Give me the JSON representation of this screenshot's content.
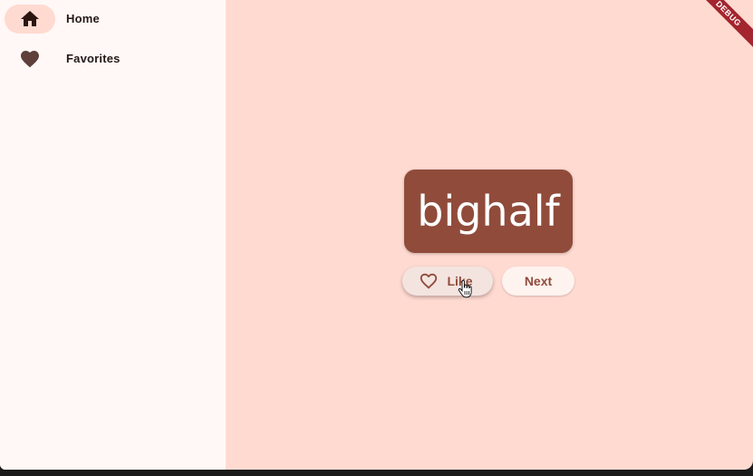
{
  "colors": {
    "rail_bg": "#fff8f6",
    "content_bg": "#ffdad1",
    "accent": "#904b3b",
    "indicator": "#ffdad1",
    "debug_banner": "#a3252e"
  },
  "nav": {
    "items": [
      {
        "label": "Home",
        "icon": "home-icon",
        "selected": true
      },
      {
        "label": "Favorites",
        "icon": "heart-icon",
        "selected": false
      }
    ]
  },
  "card": {
    "word": "bighalf"
  },
  "actions": {
    "like_label": "Like",
    "like_icon": "heart-outline-icon",
    "next_label": "Next"
  },
  "debug": {
    "banner_text": "DEBUG"
  }
}
